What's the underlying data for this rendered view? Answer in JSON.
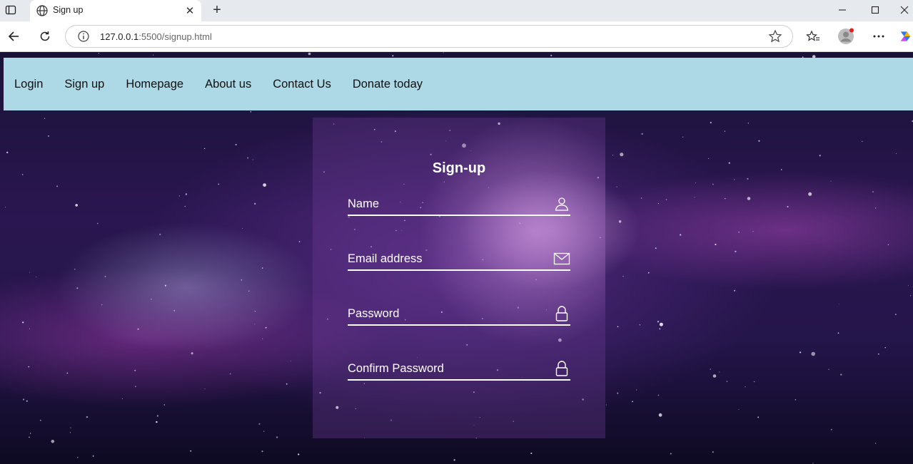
{
  "browser": {
    "tab_title": "Sign up",
    "url_host": "127.0.0.1",
    "url_rest": ":5500/signup.html"
  },
  "site_nav": {
    "links": [
      "Login",
      "Sign up",
      "Homepage",
      "About us",
      "Contact Us",
      "Donate today"
    ]
  },
  "form": {
    "title": "Sign-up",
    "fields": [
      {
        "label": "Name",
        "icon": "person-icon"
      },
      {
        "label": "Email address",
        "icon": "mail-icon"
      },
      {
        "label": "Password",
        "icon": "lock-icon"
      },
      {
        "label": "Confirm Password",
        "icon": "lock-icon"
      }
    ]
  },
  "colors": {
    "nav_background": "#add8e6",
    "text_on_card": "#ffffff"
  }
}
